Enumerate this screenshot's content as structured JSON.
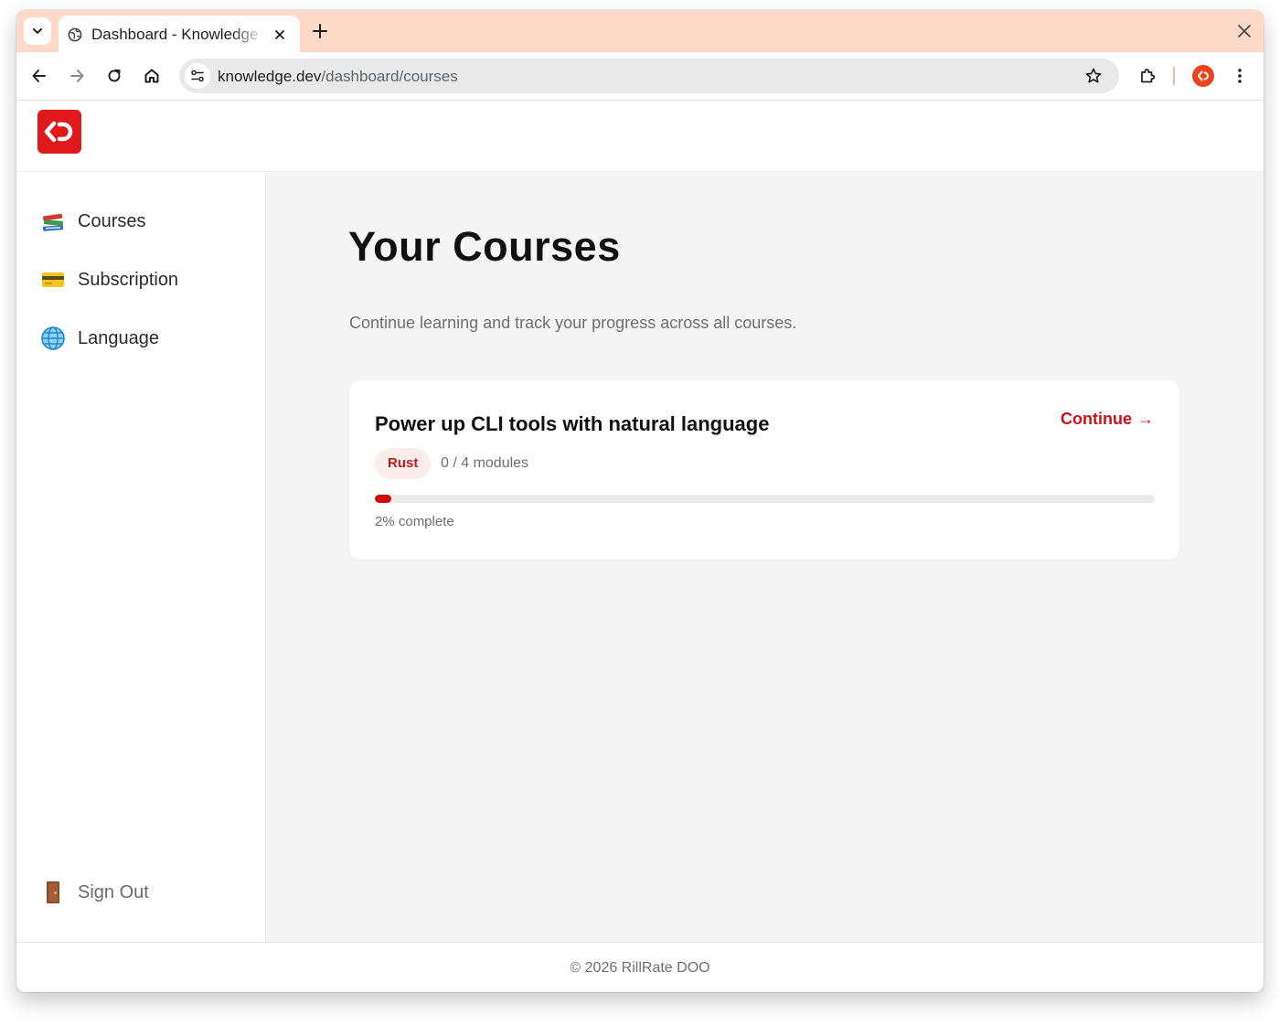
{
  "browser": {
    "tab": {
      "title": "Dashboard - Knowledge"
    },
    "address": {
      "host": "knowledge.dev",
      "path": "/dashboard/courses"
    }
  },
  "sidebar": {
    "items": [
      {
        "label": "Courses",
        "icon": "books-icon"
      },
      {
        "label": "Subscription",
        "icon": "credit-card-icon"
      },
      {
        "label": "Language",
        "icon": "globe-icon"
      }
    ],
    "signout": {
      "label": "Sign Out",
      "icon": "door-icon"
    }
  },
  "main": {
    "title": "Your Courses",
    "subtitle": "Continue learning and track your progress across all courses.",
    "courses": [
      {
        "title": "Power up CLI tools with natural language",
        "tag": "Rust",
        "modules": "0 / 4 modules",
        "progress": 0.02,
        "progress_text": "2% complete",
        "action": "Continue",
        "action_arrow": "→"
      }
    ]
  },
  "footer": {
    "text": "© 2026 RillRate DOO"
  },
  "colors": {
    "brand": "#e0191d",
    "accent_text": "#cc1016",
    "tab_strip": "#fcdac7",
    "main_bg": "#f5f5f5",
    "progress": "#d00a0a"
  }
}
